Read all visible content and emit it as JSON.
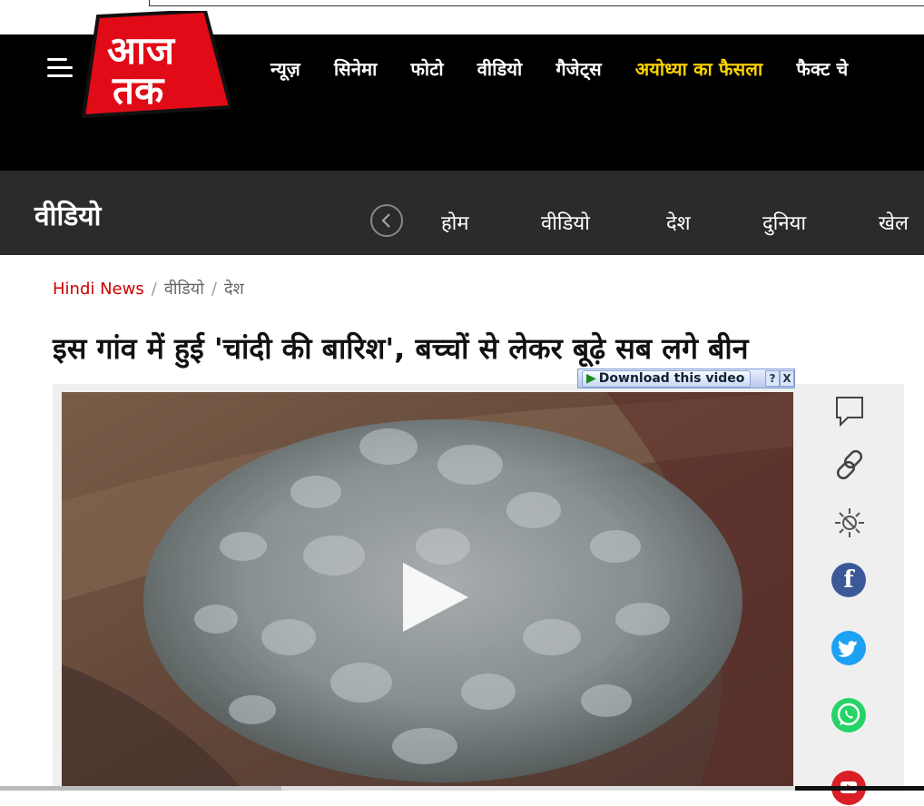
{
  "logo": {
    "line1": "आज",
    "line2": "तक"
  },
  "nav": {
    "items": [
      {
        "label": "न्यूज़",
        "highlight": false
      },
      {
        "label": "सिनेमा",
        "highlight": false
      },
      {
        "label": "फोटो",
        "highlight": false
      },
      {
        "label": "वीडियो",
        "highlight": false
      },
      {
        "label": "गैजेट्स",
        "highlight": false
      },
      {
        "label": "अयोध्या का फैसला",
        "highlight": true
      },
      {
        "label": "फैक्ट चे",
        "highlight": false
      }
    ]
  },
  "section": {
    "title": "वीडियो",
    "items": [
      "होम",
      "वीडियो",
      "देश",
      "दुनिया",
      "खेल"
    ]
  },
  "breadcrumb": {
    "home": "Hindi News",
    "sep": "/",
    "level2": "वीडियो",
    "level3": "देश"
  },
  "article": {
    "headline": "इस गांव में हुई 'चांदी की बारिश', बच्चों से लेकर बूढ़े सब लगे बीन"
  },
  "download_bar": {
    "label": "Download this video",
    "help": "?",
    "close": "X"
  },
  "share": {
    "icons": [
      "comment-icon",
      "link-icon",
      "brightness-icon",
      "facebook-icon",
      "twitter-icon",
      "whatsapp-icon",
      "youtube-icon"
    ],
    "facebook_letter": "f",
    "colors": {
      "facebook": "#3b5998",
      "twitter": "#1da1f2",
      "whatsapp": "#25d366",
      "youtube": "#d81f26"
    }
  },
  "colors": {
    "highlight_nav": "#ffd400",
    "breadcrumb_home": "#cc0000",
    "navbar_bg": "#000000",
    "subbar_bg": "#2b2b2b"
  }
}
